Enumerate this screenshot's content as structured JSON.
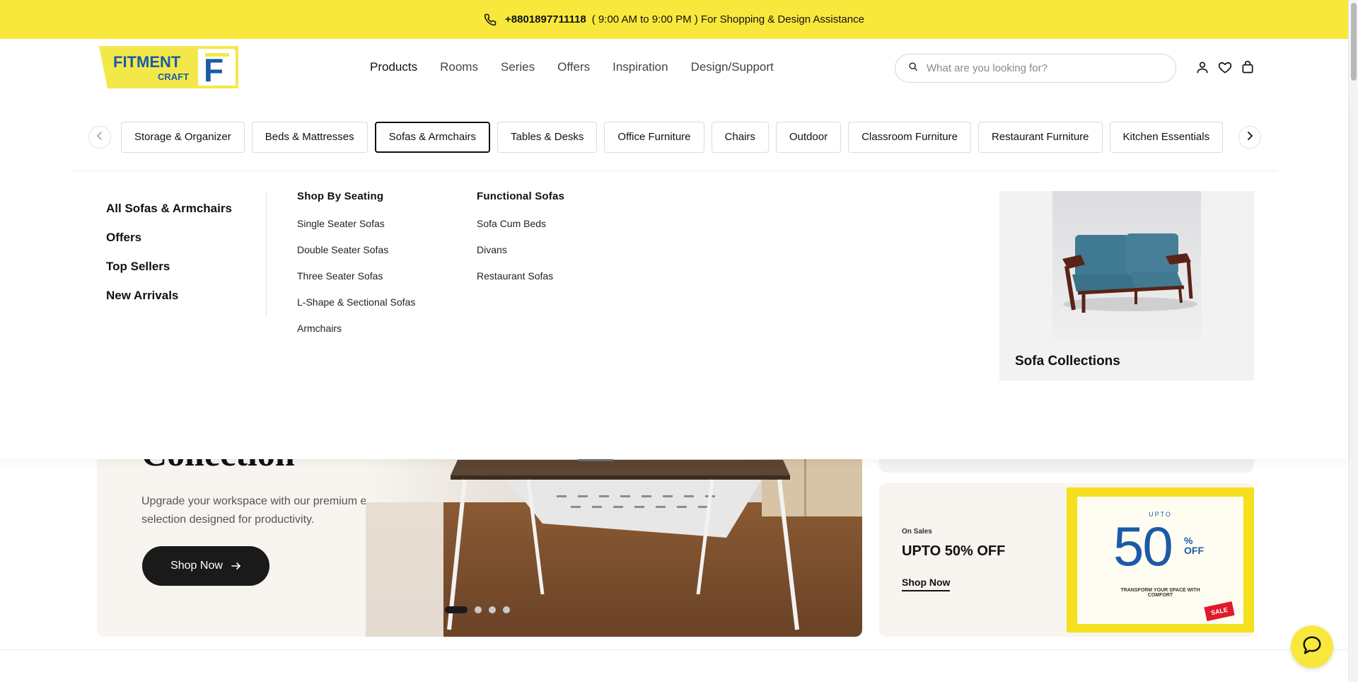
{
  "announcement": {
    "phone": "+8801897711118",
    "hours_text": "( 9:00 AM to 9:00 PM ) For Shopping & Design Assistance"
  },
  "logo": {
    "line1": "FITMENT",
    "line2": "CRAFT",
    "mark": "F"
  },
  "nav": [
    "Products",
    "Rooms",
    "Series",
    "Offers",
    "Inspiration",
    "Design/Support"
  ],
  "search": {
    "placeholder": "What are you looking for?"
  },
  "icons": {
    "account": "user-icon",
    "wishlist": "heart-icon",
    "cart": "bag-icon",
    "search": "search-icon",
    "phone": "phone-icon"
  },
  "categories": [
    "Storage & Organizer",
    "Beds & Mattresses",
    "Sofas & Armchairs",
    "Tables & Desks",
    "Office Furniture",
    "Chairs",
    "Outdoor",
    "Classroom Furniture",
    "Restaurant Furniture",
    "Kitchen Essentials"
  ],
  "active_category": "Sofas & Armchairs",
  "menu": {
    "primary": [
      "All Sofas & Armchairs",
      "Offers",
      "Top Sellers",
      "New Arrivals"
    ],
    "shop_by_seating": {
      "heading": "Shop By Seating",
      "items": [
        "Single Seater Sofas",
        "Double Seater Sofas",
        "Three Seater Sofas",
        "L-Shape & Sectional Sofas",
        "Armchairs"
      ]
    },
    "functional": {
      "heading": "Functional Sofas",
      "items": [
        "Sofa Cum Beds",
        "Divans",
        "Restaurant Sofas"
      ]
    },
    "promo_title": "Sofa Collections"
  },
  "hero": {
    "headline": "Collection",
    "sub": "Upgrade your workspace with our premium ergonomic selection designed for productivity.",
    "button": "Shop Now",
    "slides": 4,
    "active_slide": 1
  },
  "sale_card": {
    "eyebrow": "On Sales",
    "title": "UPTO 50% OFF",
    "link": "Shop Now",
    "stamp_upto": "UPTO",
    "stamp_value": "50",
    "stamp_pct": "%",
    "stamp_off": "OFF",
    "stamp_line1": "TRANSFORM YOUR SPACE WITH",
    "stamp_line2": "COMFORT",
    "stamp_badge": "SALE"
  },
  "colors": {
    "brand_yellow": "#f9e83c",
    "brand_blue": "#1c5aa8",
    "dark": "#1a1a1a",
    "sale_red": "#e0192b"
  }
}
